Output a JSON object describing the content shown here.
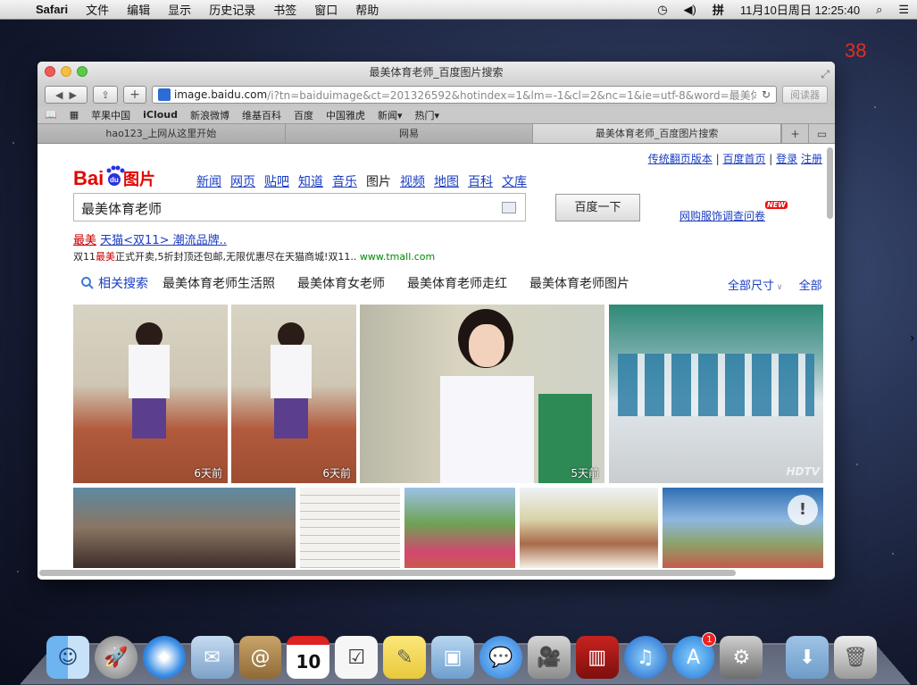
{
  "menubar": {
    "app_name": "Safari",
    "menus": [
      "文件",
      "编辑",
      "显示",
      "历史记录",
      "书签",
      "窗口",
      "帮助"
    ],
    "datetime": "11月10日周日  12:25:40"
  },
  "counter": "38",
  "window": {
    "title": "最美体育老师_百度图片搜索",
    "url_host": "image.baidu.com",
    "url_path": "/i?tn=baiduimage&ct=201326592&hotindex=1&lm=-1&cl=2&nc=1&ie=utf-8&word=最美体育老师",
    "reader_label": "阅读器",
    "favorites": [
      "苹果中国",
      "iCloud",
      "新浪微博",
      "维基百科",
      "百度",
      "中国雅虎",
      "新闻▾",
      "热门▾"
    ],
    "tabs": [
      "hao123_上网从这里开始",
      "网易",
      "最美体育老师_百度图片搜索"
    ]
  },
  "page": {
    "top_links": [
      "传统翻页版本",
      "百度首页",
      "登录",
      "注册"
    ],
    "nav": [
      "新闻",
      "网页",
      "贴吧",
      "知道",
      "音乐",
      "图片",
      "视频",
      "地图",
      "百科",
      "文库"
    ],
    "nav_current": "图片",
    "search_value": "最美体育老师",
    "search_button": "百度一下",
    "survey_link": "网购服饰调查问卷",
    "survey_badge": "NEW",
    "ad_title_red": "最美",
    "ad_title_link": "天猫<双11> 潮流品牌..",
    "ad_desc_pre": "双11",
    "ad_desc_red": "最美",
    "ad_desc_post": "正式开卖,5折封顶还包邮,无限优惠尽在天猫商城!双11..",
    "ad_url": "www.tmall.com",
    "related_label": "相关搜索",
    "related": [
      "最美体育老师生活照",
      "最美体育女老师",
      "最美体育老师走红",
      "最美体育老师图片"
    ],
    "filter_size": "全部尺寸",
    "filter_all": "全部",
    "thumb_ages": [
      "6天前",
      "6天前",
      "5天前"
    ],
    "watermark": "HDTV"
  },
  "dock": {
    "items": [
      "finder-icon",
      "launchpad-icon",
      "safari-icon",
      "mail-icon",
      "contacts-icon",
      "calendar-icon",
      "reminders-icon",
      "notes-icon",
      "preview-icon",
      "messages-icon",
      "facetime-icon",
      "photobooth-icon",
      "itunes-icon",
      "appstore-icon",
      "system-preferences-icon",
      "downloads-folder-icon",
      "trash-icon"
    ],
    "calendar_day": "10",
    "appstore_badge": "1"
  }
}
